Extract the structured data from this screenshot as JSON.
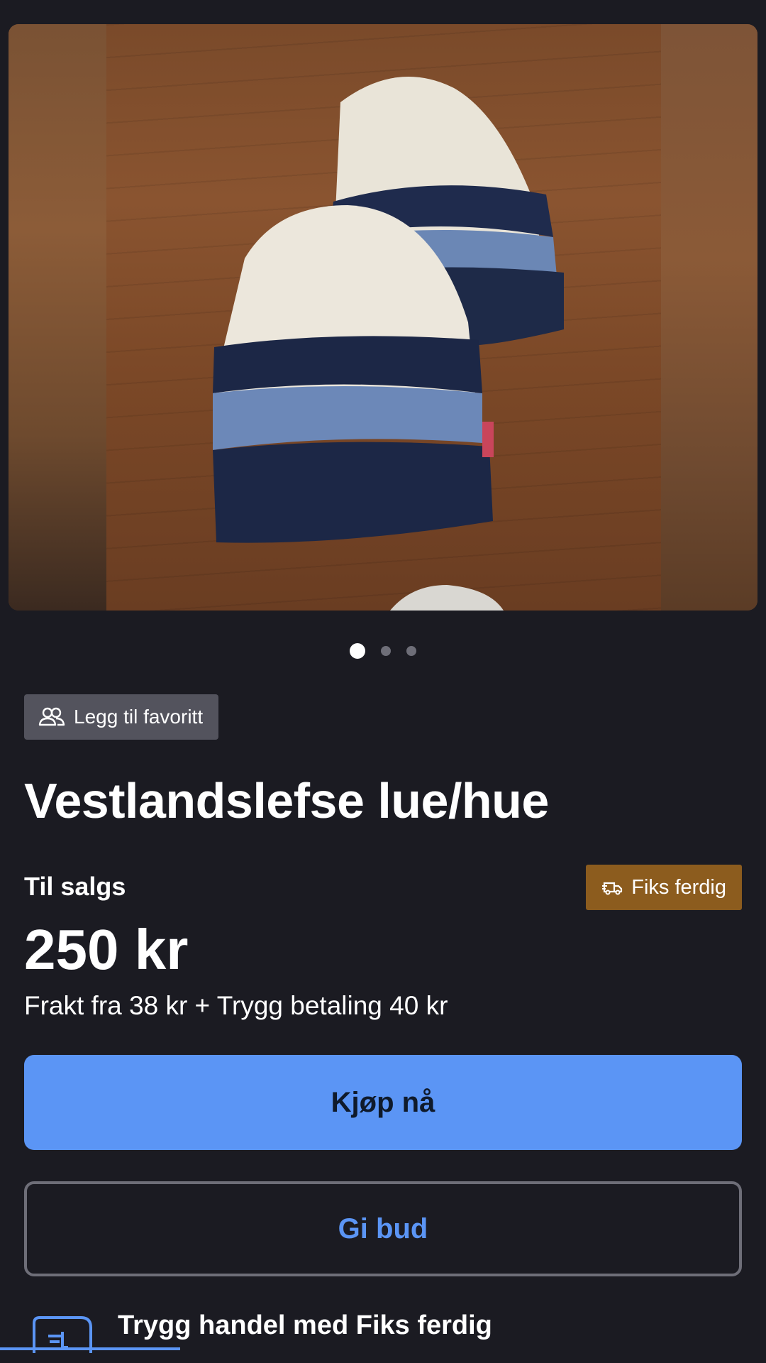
{
  "listing": {
    "favorite_label": "Legg til favoritt",
    "title": "Vestlandslefse lue/hue",
    "status": "Til salgs",
    "badge_label": "Fiks ferdig",
    "price": "250 kr",
    "shipping": "Frakt fra 38 kr + Trygg betaling 40 kr"
  },
  "gallery": {
    "image_count": 3,
    "active_index": 0
  },
  "actions": {
    "buy_label": "Kjøp nå",
    "bid_label": "Gi bud"
  },
  "safe_trade": {
    "title": "Trygg handel med Fiks ferdig"
  },
  "colors": {
    "background": "#1b1b22",
    "primary": "#5b95f5",
    "badge": "#8c5c1e"
  },
  "icons": {
    "favorite": "people-icon",
    "badge": "delivery-truck-icon",
    "safe_trade": "shipping-truck-icon"
  }
}
